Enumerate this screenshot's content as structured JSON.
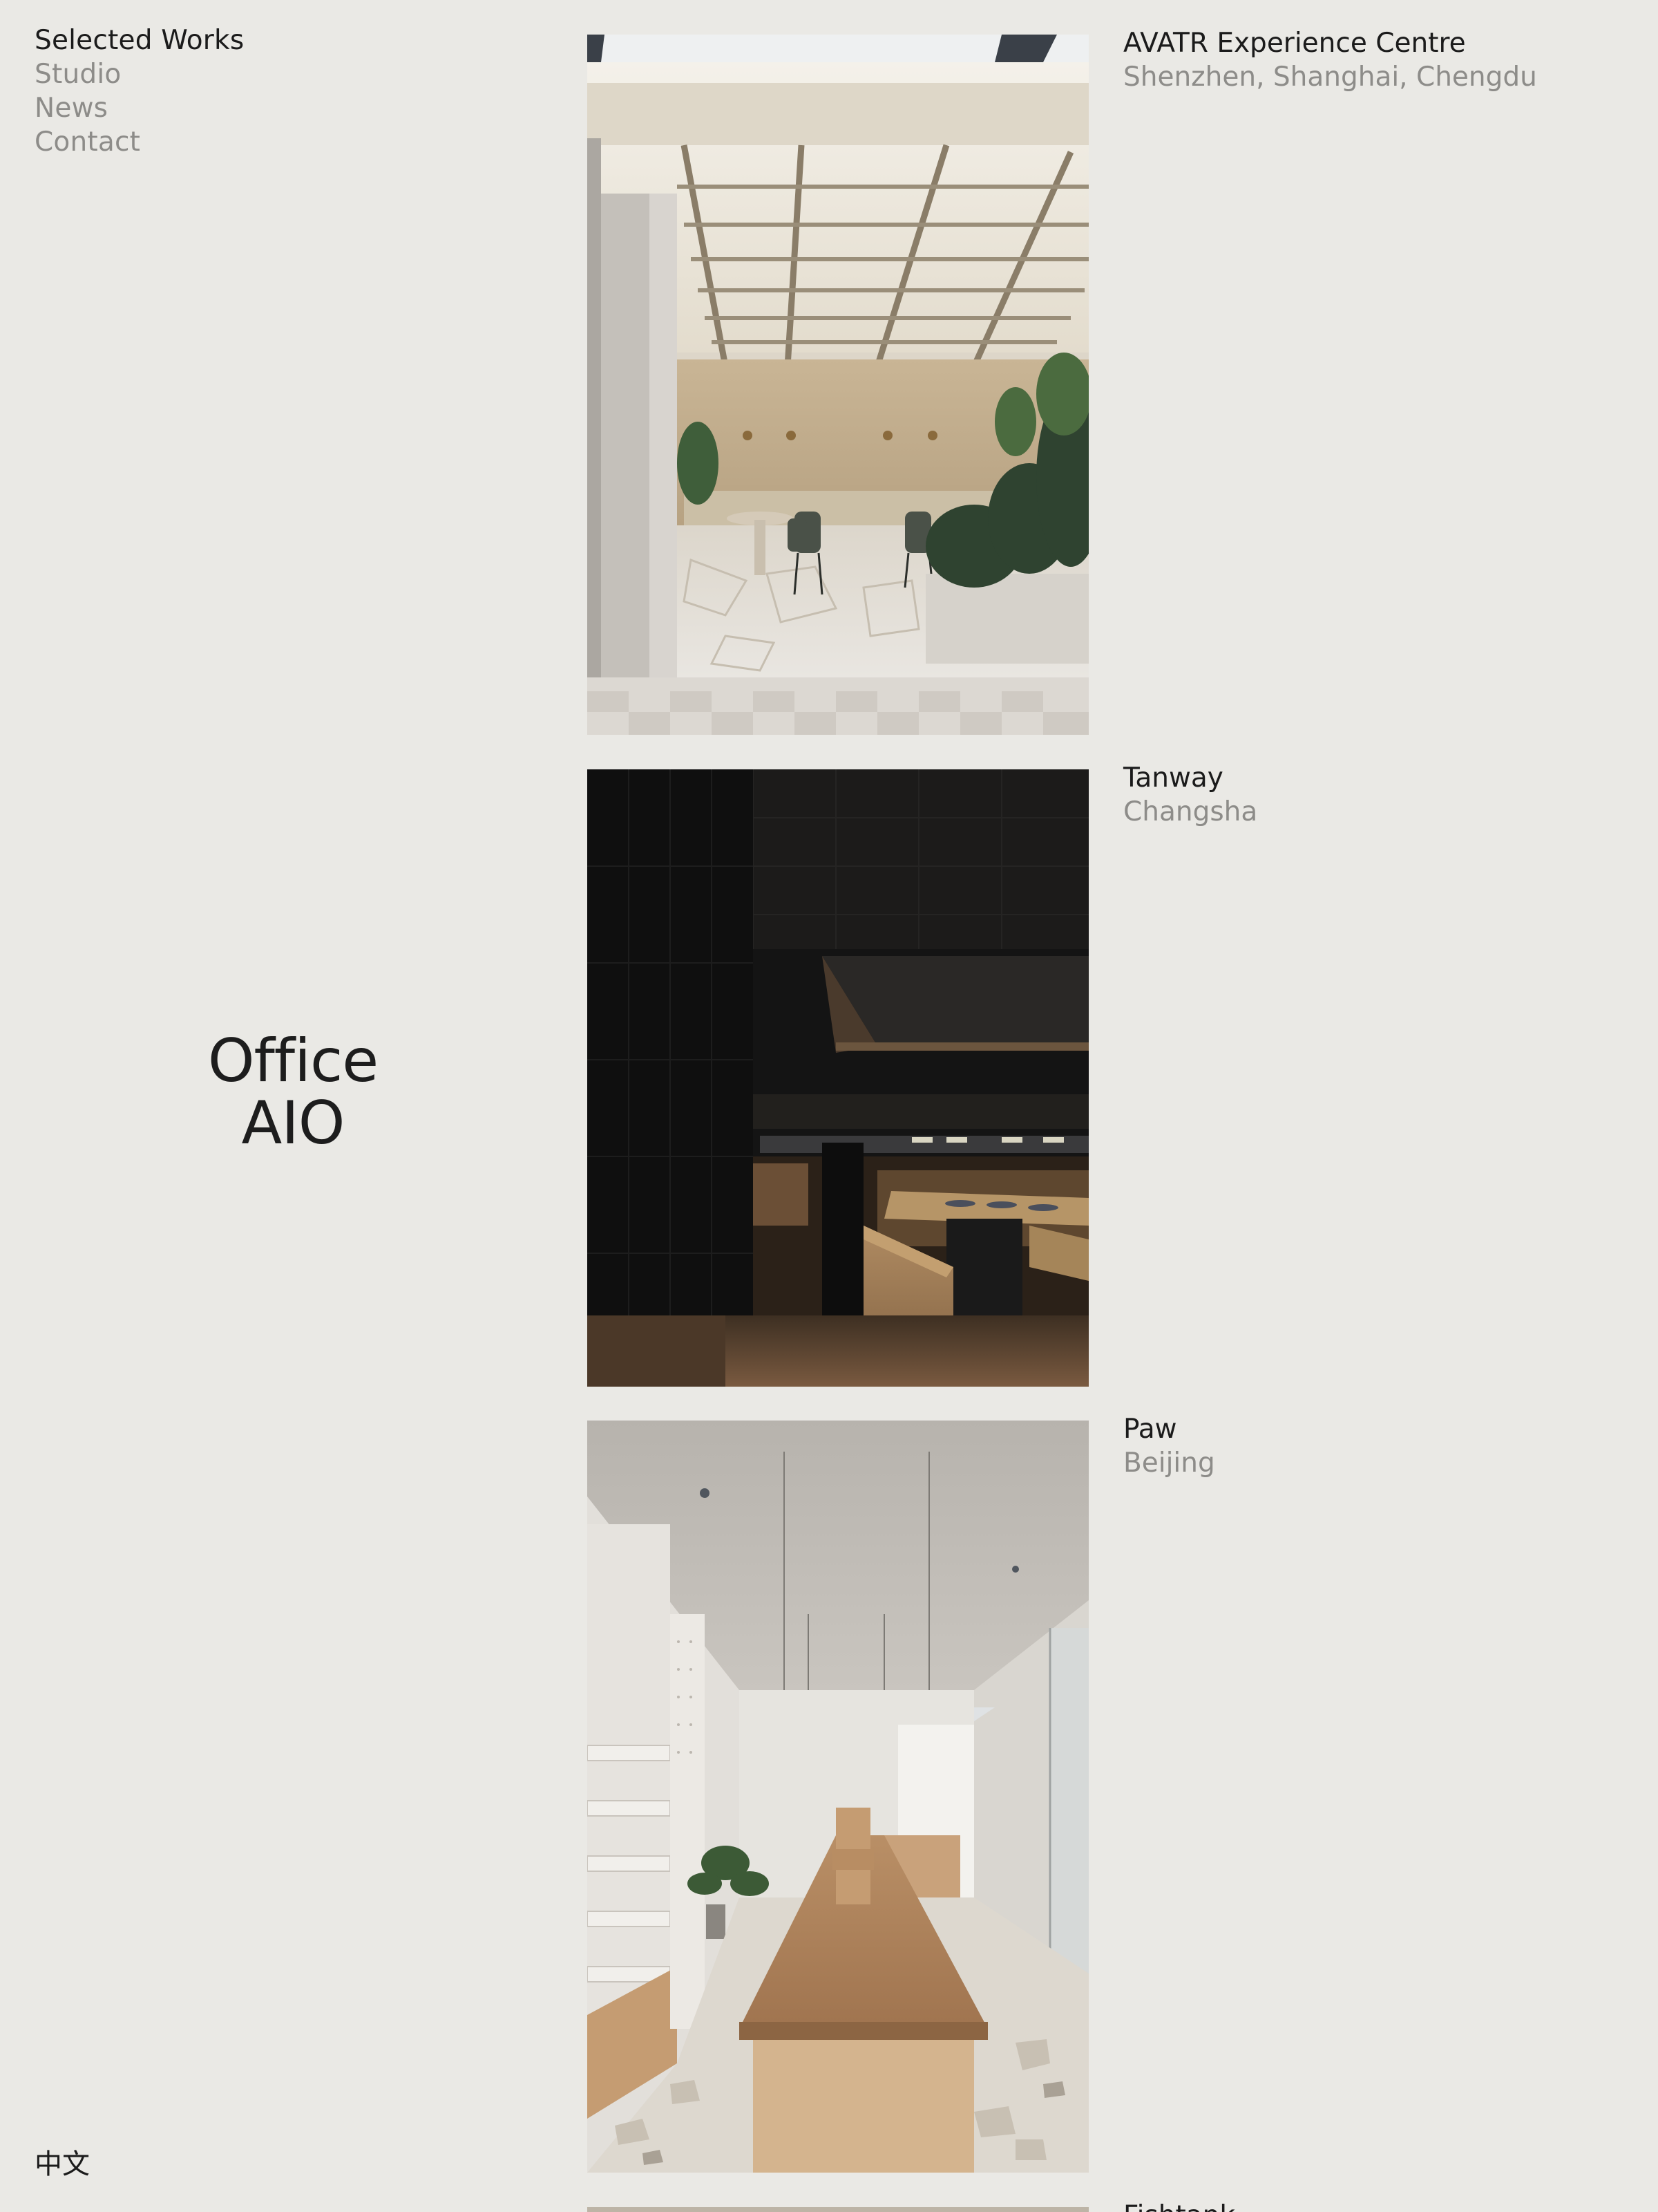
{
  "nav": {
    "items": [
      {
        "label": "Selected Works",
        "active": true
      },
      {
        "label": "Studio",
        "active": false
      },
      {
        "label": "News",
        "active": false
      },
      {
        "label": "Contact",
        "active": false
      }
    ]
  },
  "logo": {
    "line1": "Office",
    "line2": "AIO"
  },
  "language": {
    "label": "中文"
  },
  "projects": [
    {
      "name": "AVATR Experience Centre",
      "location": "Shenzhen, Shanghai, Chengdu"
    },
    {
      "name": "Tanway",
      "location": "Changsha"
    },
    {
      "name": "Paw",
      "location": "Beijing"
    },
    {
      "name": "Fishtank",
      "location": ""
    }
  ],
  "colors": {
    "background": "#eae9e5",
    "text_primary": "#1b1b1b",
    "text_secondary": "#8d8c89"
  }
}
